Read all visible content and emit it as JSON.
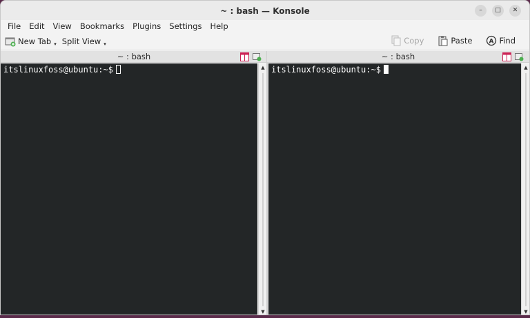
{
  "window": {
    "title": "~ : bash — Konsole",
    "controls": {
      "minimize": "–",
      "maximize": "□",
      "close": "✕"
    }
  },
  "menu": [
    "File",
    "Edit",
    "View",
    "Bookmarks",
    "Plugins",
    "Settings",
    "Help"
  ],
  "toolbar": {
    "new_tab": "New Tab",
    "split_view": "Split View",
    "copy": "Copy",
    "paste": "Paste",
    "find": "Find"
  },
  "panes": [
    {
      "title": "~ : bash",
      "prompt": "itslinuxfoss@ubuntu:~$"
    },
    {
      "title": "~ : bash",
      "prompt": "itslinuxfoss@ubuntu:~$"
    }
  ],
  "colors": {
    "terminal_bg": "#232627",
    "terminal_fg": "#fcfcfc",
    "chrome_bg": "#f3f3f3"
  }
}
